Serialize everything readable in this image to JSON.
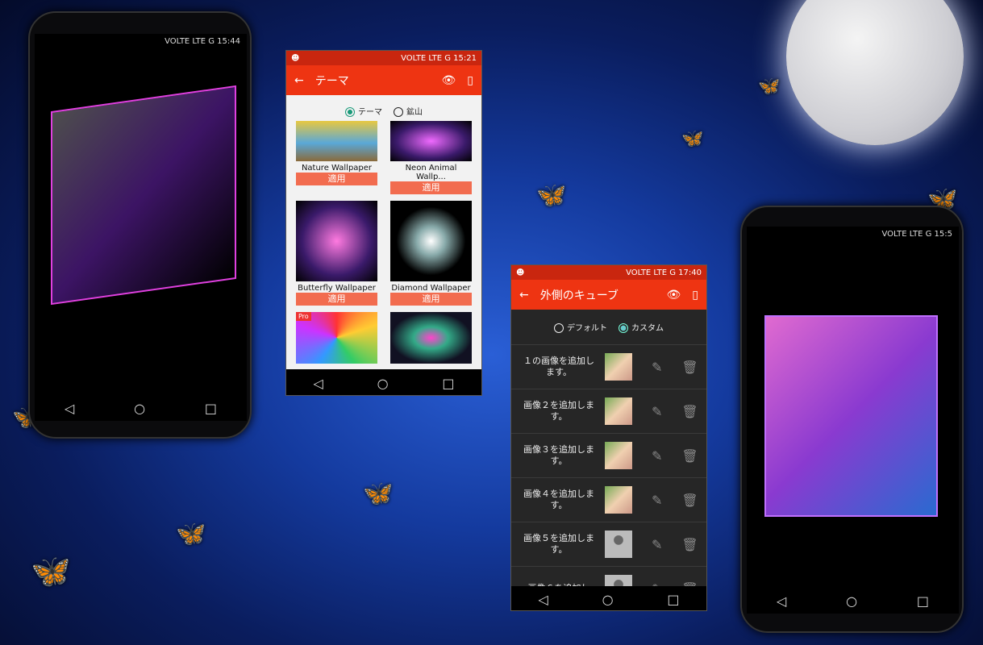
{
  "left_phone": {
    "status_time": "15:44",
    "status_icons": "VOLTE LTE G"
  },
  "right_phone": {
    "status_time": "15:5",
    "status_icons": "VOLTE LTE G"
  },
  "theme_screen": {
    "status_time": "15:21",
    "status_icons": "VOLTE LTE G",
    "title": "テーマ",
    "back_icon": "arrow-left-icon",
    "preview_icon": "eye-icon",
    "set_icon": "phone-icon",
    "radio_options": [
      {
        "label": "テーマ",
        "selected": true
      },
      {
        "label": "鉱山",
        "selected": false
      }
    ],
    "cards": [
      {
        "name": "Nature Wallpaper",
        "button": "適用",
        "colors": "#d8b84a"
      },
      {
        "name": "Neon Animal Wallp...",
        "button": "適用",
        "colors": "#8a2b9a"
      },
      {
        "name": "Butterfly Wallpaper",
        "button": "適用",
        "colors": "#3a1a6a"
      },
      {
        "name": "Diamond Wallpaper",
        "button": "適用",
        "colors": "#111"
      },
      {
        "name": "",
        "button": "",
        "badge": "Pro",
        "colors": "#c23a6a"
      },
      {
        "name": "",
        "button": "",
        "colors": "#1a2a4a"
      }
    ]
  },
  "cube_screen": {
    "status_time": "17:40",
    "status_icons": "VOLTE LTE G",
    "title": "外側のキューブ",
    "back_icon": "arrow-left-icon",
    "preview_icon": "eye-icon",
    "set_icon": "phone-icon",
    "radio_options": [
      {
        "label": "デフォルト",
        "selected": false
      },
      {
        "label": "カスタム",
        "selected": true
      }
    ],
    "rows": [
      {
        "label": "１の画像を追加します。",
        "thumb": "photo"
      },
      {
        "label": "画像２を追加します。",
        "thumb": "photo"
      },
      {
        "label": "画像３を追加します。",
        "thumb": "photo"
      },
      {
        "label": "画像４を追加します。",
        "thumb": "photo"
      },
      {
        "label": "画像５を追加します。",
        "thumb": "placeholder"
      },
      {
        "label": "画像６を追加し",
        "thumb": "placeholder"
      }
    ]
  },
  "colors": {
    "primary": "#ee3412",
    "primary_dark": "#c9260f",
    "apply_button": "#f26c4f",
    "radio_accent": "#1a9a7a"
  }
}
